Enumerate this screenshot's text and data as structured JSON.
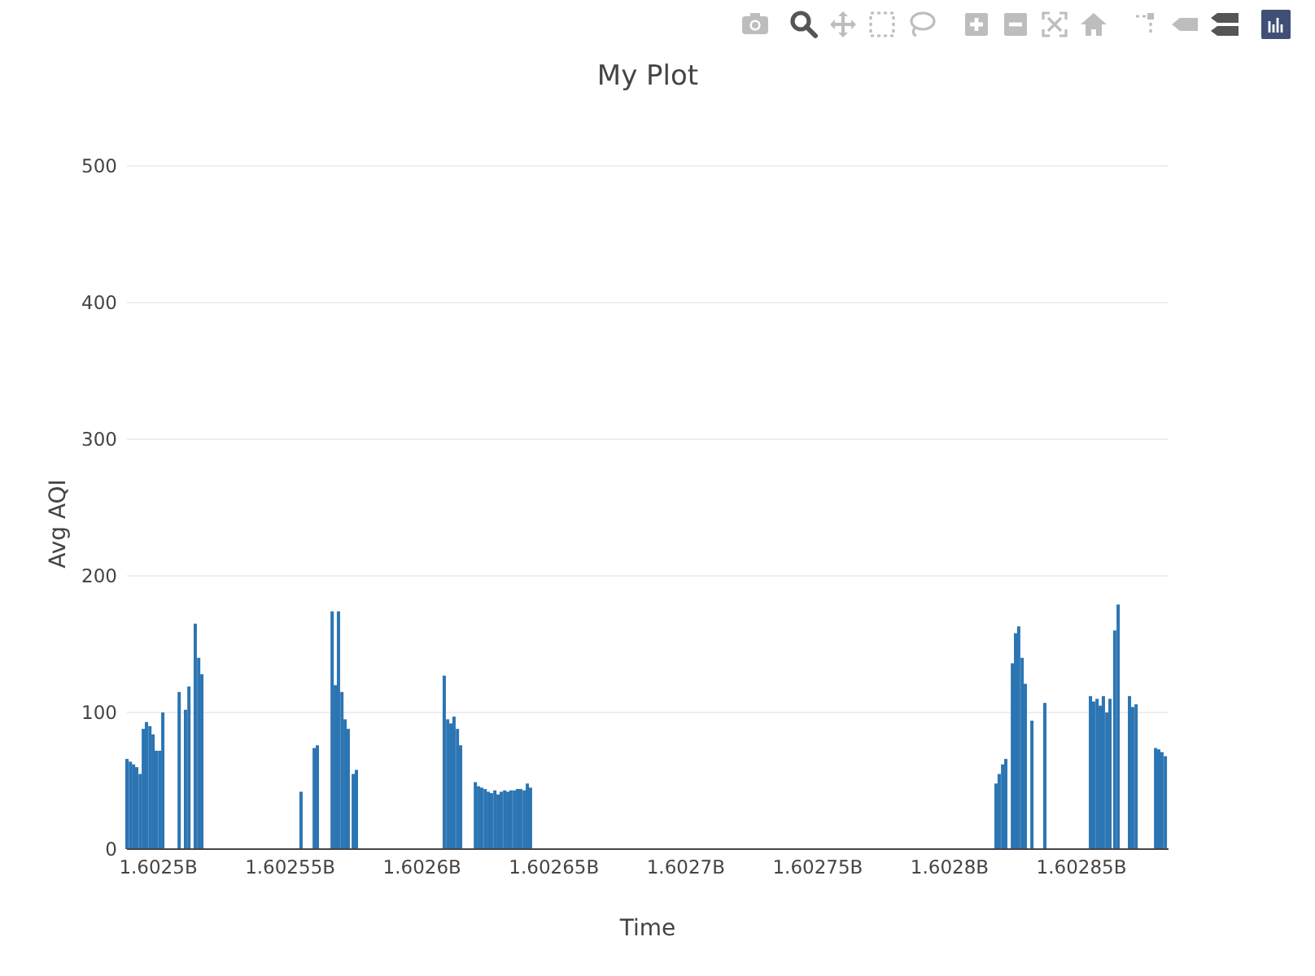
{
  "modebar": [
    {
      "kind": "camera",
      "selected": false
    },
    {
      "kind": "zoom",
      "selected": true
    },
    {
      "kind": "pan",
      "selected": false
    },
    {
      "kind": "box-select",
      "selected": false
    },
    {
      "kind": "lasso",
      "selected": false
    },
    {
      "kind": "zoom-in",
      "selected": false
    },
    {
      "kind": "zoom-out",
      "selected": false
    },
    {
      "kind": "autoscale",
      "selected": false
    },
    {
      "kind": "home",
      "selected": false
    },
    {
      "kind": "spikelines",
      "selected": false
    },
    {
      "kind": "hover-closest",
      "selected": false
    },
    {
      "kind": "hover-compare",
      "selected": true
    },
    {
      "kind": "logo"
    }
  ],
  "chart_data": {
    "type": "bar",
    "title": "My Plot",
    "xlabel": "Time",
    "ylabel": "Avg AQI",
    "xlim": [
      1602488100,
      1602883000
    ],
    "grid": true,
    "ylim": [
      0,
      500
    ],
    "yticks": [
      0,
      100,
      200,
      300,
      400,
      500
    ],
    "xticks": [
      {
        "value": 1602500000,
        "label": "1.6025B"
      },
      {
        "value": 1602550000,
        "label": "1.60255B"
      },
      {
        "value": 1602600000,
        "label": "1.6026B"
      },
      {
        "value": 1602650000,
        "label": "1.60265B"
      },
      {
        "value": 1602700000,
        "label": "1.6027B"
      },
      {
        "value": 1602750000,
        "label": "1.60275B"
      },
      {
        "value": 1602800000,
        "label": "1.6028B"
      },
      {
        "value": 1602850000,
        "label": "1.60285B"
      }
    ],
    "x": [
      1602488100,
      1602489400,
      1602490600,
      1602491800,
      1602493100,
      1602494300,
      1602495500,
      1602496800,
      1602498000,
      1602499200,
      1602500500,
      1602501700,
      1602507900,
      1602510300,
      1602511600,
      1602514000,
      1602515300,
      1602516500,
      1602554100,
      1602559100,
      1602560300,
      1602565900,
      1602567100,
      1602568300,
      1602569600,
      1602570800,
      1602572000,
      1602573900,
      1602575100,
      1602608400,
      1602609700,
      1602610900,
      1602612100,
      1602613400,
      1602614600,
      1602620200,
      1602621400,
      1602622600,
      1602623900,
      1602625100,
      1602626300,
      1602627600,
      1602628800,
      1602630000,
      1602631300,
      1602632500,
      1602633700,
      1602635000,
      1602636200,
      1602637400,
      1602638700,
      1602639900,
      1602641100,
      1602817600,
      1602818800,
      1602820100,
      1602821300,
      1602823800,
      1602825000,
      1602826200,
      1602827500,
      1602828700,
      1602831200,
      1602836100,
      1602853400,
      1602854600,
      1602855900,
      1602857100,
      1602858300,
      1602859600,
      1602860800,
      1602862600,
      1602863900,
      1602868200,
      1602869400,
      1602870700,
      1602878100,
      1602879300,
      1602880500,
      1602881800
    ],
    "series": [
      {
        "color": "#2c75b3",
        "values": [
          66,
          64,
          62,
          60,
          55,
          88,
          93,
          90,
          84,
          72,
          72,
          100,
          115,
          102,
          119,
          165,
          140,
          128,
          42,
          74,
          76,
          174,
          120,
          174,
          115,
          95,
          88,
          55,
          58,
          127,
          95,
          92,
          97,
          88,
          76,
          49,
          46,
          45,
          44,
          42,
          41,
          43,
          40,
          42,
          43,
          42,
          43,
          43,
          44,
          44,
          43,
          48,
          45,
          48,
          55,
          62,
          66,
          136,
          158,
          163,
          140,
          121,
          94,
          107,
          112,
          108,
          110,
          105,
          112,
          100,
          110,
          160,
          179,
          112,
          104,
          106,
          74,
          73,
          71,
          68
        ]
      }
    ]
  }
}
